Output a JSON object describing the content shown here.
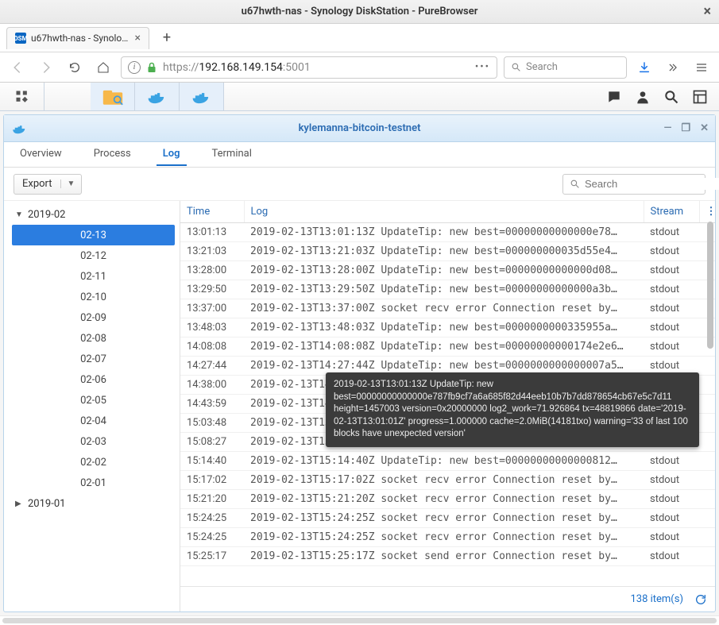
{
  "window": {
    "title": "u67hwth-nas - Synology DiskStation - PureBrowser"
  },
  "browser_tab": {
    "favicon": "DSM",
    "label": "u67hwth-nas - Synology"
  },
  "url": {
    "scheme": "https://",
    "host": "192.168.149.154",
    "port": ":5001"
  },
  "browser_search_placeholder": "Search",
  "docker_window": {
    "title": "kylemanna-bitcoin-testnet"
  },
  "tabs": {
    "overview": "Overview",
    "process": "Process",
    "log": "Log",
    "terminal": "Terminal"
  },
  "export_label": "Export",
  "log_search_placeholder": "Search",
  "tree": {
    "months": [
      {
        "label": "2019-02",
        "expanded": true,
        "days": [
          "02-13",
          "02-12",
          "02-11",
          "02-10",
          "02-09",
          "02-08",
          "02-07",
          "02-06",
          "02-05",
          "02-04",
          "02-03",
          "02-02",
          "02-01"
        ],
        "selected": "02-13"
      },
      {
        "label": "2019-01",
        "expanded": false,
        "days": []
      }
    ]
  },
  "headers": {
    "time": "Time",
    "log": "Log",
    "stream": "Stream"
  },
  "rows": [
    {
      "time": "13:01:13",
      "log": "2019-02-13T13:01:13Z UpdateTip: new best=00000000000000e78…",
      "stream": "stdout"
    },
    {
      "time": "13:21:03",
      "log": "2019-02-13T13:21:03Z UpdateTip: new best=000000000035d55e4…",
      "stream": "stdout"
    },
    {
      "time": "13:28:00",
      "log": "2019-02-13T13:28:00Z UpdateTip: new best=00000000000000d08…",
      "stream": "stdout"
    },
    {
      "time": "13:29:50",
      "log": "2019-02-13T13:29:50Z UpdateTip: new best=00000000000000a3b…",
      "stream": "stdout"
    },
    {
      "time": "13:37:00",
      "log": "2019-02-13T13:37:00Z socket recv error Connection reset by…",
      "stream": "stdout"
    },
    {
      "time": "13:48:03",
      "log": "2019-02-13T13:48:03Z UpdateTip: new best=0000000000335955a…",
      "stream": "stdout"
    },
    {
      "time": "14:08:08",
      "log": "2019-02-13T14:08:08Z UpdateTip: new best=00000000000174e2e6…",
      "stream": "stdout"
    },
    {
      "time": "14:27:44",
      "log": "2019-02-13T14:27:44Z UpdateTip: new best=0000000000000007a5…",
      "stream": "stdout"
    },
    {
      "time": "14:38:00",
      "log": "2019-02-13T14:38:00Z socket recv error Connection reset by…",
      "stream": "stdout"
    },
    {
      "time": "14:43:59",
      "log": "2019-02-13T14:43:59Z UpdateTip: new best=0000000000000007fd…",
      "stream": "stdout"
    },
    {
      "time": "15:03:48",
      "log": "2019-02-13T15:03:48Z UpdateTip: new best=0000000000003ed0868…",
      "stream": "stdout"
    },
    {
      "time": "15:08:27",
      "log": "2019-02-13T15:08:27Z UpdateTip: new best=00000000000000d98…",
      "stream": "stdout"
    },
    {
      "time": "15:14:40",
      "log": "2019-02-13T15:14:40Z UpdateTip: new best=00000000000000812…",
      "stream": "stdout"
    },
    {
      "time": "15:17:02",
      "log": "2019-02-13T15:17:02Z socket recv error Connection reset by…",
      "stream": "stdout"
    },
    {
      "time": "15:21:20",
      "log": "2019-02-13T15:21:20Z socket recv error Connection reset by…",
      "stream": "stdout"
    },
    {
      "time": "15:24:25",
      "log": "2019-02-13T15:24:25Z socket recv error Connection reset by…",
      "stream": "stdout"
    },
    {
      "time": "15:24:25",
      "log": "2019-02-13T15:24:25Z socket recv error Connection reset by…",
      "stream": "stdout"
    },
    {
      "time": "15:25:17",
      "log": "2019-02-13T15:25:17Z socket send error Connection reset by…",
      "stream": "stdout"
    }
  ],
  "item_count": "138 item(s)",
  "tooltip": "2019-02-13T13:01:13Z UpdateTip: new best=00000000000000e787fb9cf7a6a685f82d44eeb10b7b7dd878654cb67e5c7d11 height=1457003 version=0x20000000 log2_work=71.926864 tx=48819866 date='2019-02-13T13:01:01Z' progress=1.000000 cache=2.0MiB(14181txo) warning='33 of last 100 blocks have unexpected version'"
}
